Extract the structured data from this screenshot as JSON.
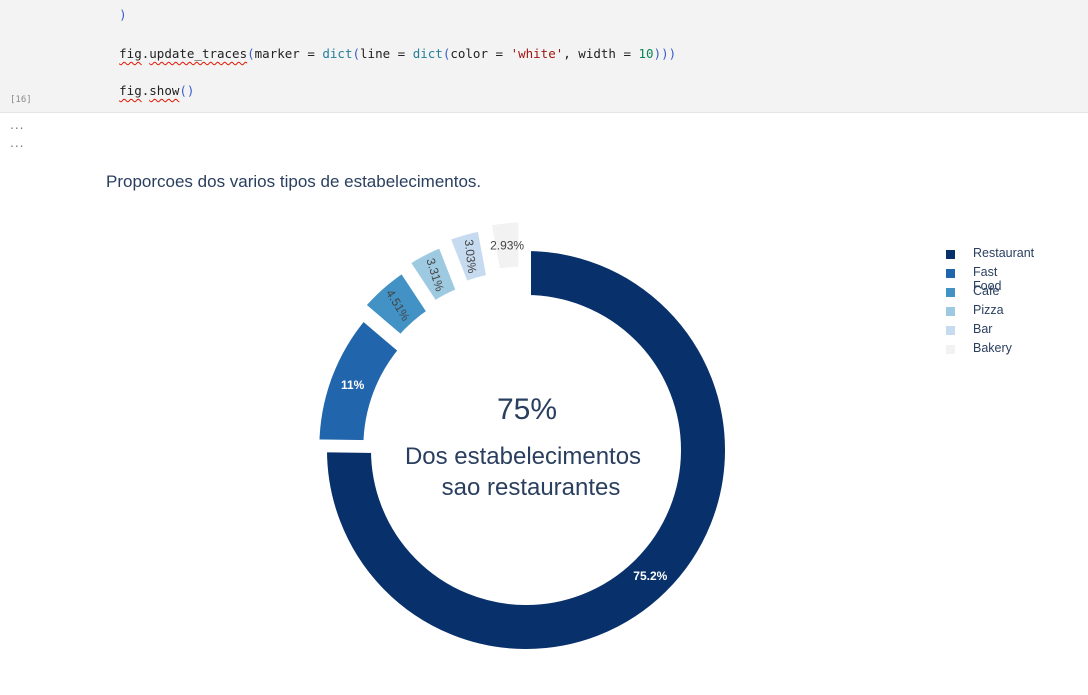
{
  "notebook": {
    "code_lines": {
      "line0": ")",
      "line1": {
        "obj": "fig",
        "dot": ".",
        "method": "update_traces",
        "open": "(",
        "arg1": "marker = ",
        "dict1": "dict",
        "open2": "(",
        "arg2": "line = ",
        "dict2": "dict",
        "open3": "(",
        "arg3": "color = ",
        "str": "'white'",
        "sep": ", width = ",
        "num": "10",
        "close": ")))"
      },
      "line2": {
        "obj": "fig",
        "dot": ".",
        "method": "show",
        "parens": "()"
      }
    },
    "execution_count": "[16]",
    "output_ellipsis_1": "...",
    "output_ellipsis_2": "..."
  },
  "chart_data": {
    "type": "pie",
    "hole": true,
    "title": "Proporcoes dos varios tipos de estabelecimentos.",
    "center_annotation": {
      "big": "75%",
      "line1": "Dos estabelecimentos",
      "line2": "sao restaurantes"
    },
    "slices": [
      {
        "name": "Restaurant",
        "value": 75.2,
        "label": "75.2%",
        "color": "#08306b",
        "pull": 0
      },
      {
        "name": "Fast Food",
        "value": 11,
        "label": "11%",
        "color": "#2166ac",
        "pull": 0.04
      },
      {
        "name": "Cafe",
        "value": 4.51,
        "label": "4.51%",
        "color": "#4292c6",
        "pull": 0.08
      },
      {
        "name": "Pizza",
        "value": 3.31,
        "label": "3.31%",
        "color": "#9ecae1",
        "pull": 0.1
      },
      {
        "name": "Bar",
        "value": 3.03,
        "label": "3.03%",
        "color": "#c6dbef",
        "pull": 0.12
      },
      {
        "name": "Bakery",
        "value": 2.93,
        "label": "2.93%",
        "color": "#f2f2f2",
        "pull": 0.14
      }
    ],
    "legend_position": "top-right",
    "colors": {
      "title": "#2a3f5f",
      "inside_label_dark_bg": "#ffffff",
      "inside_label_light_bg": "#444444"
    }
  }
}
